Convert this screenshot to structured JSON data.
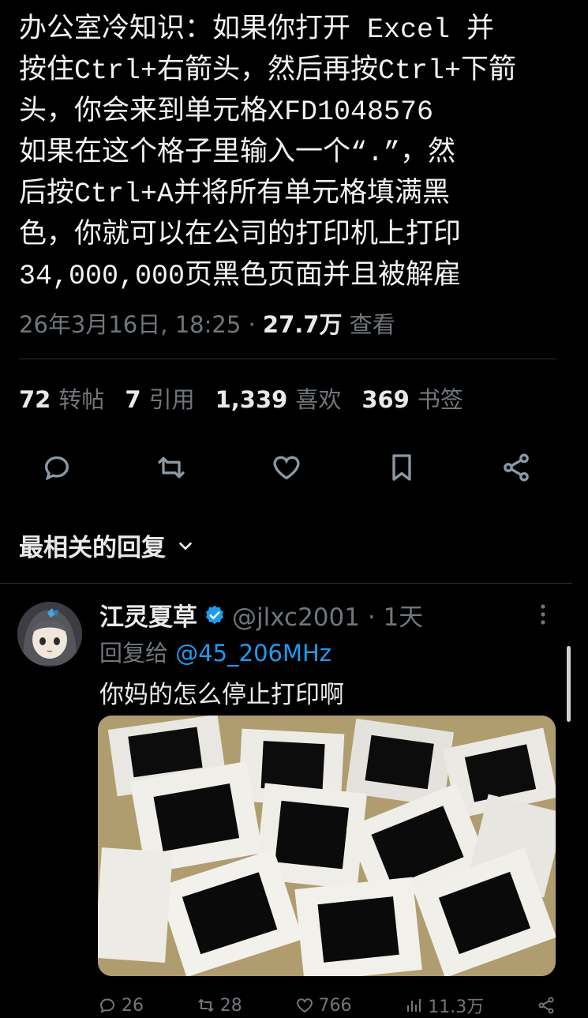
{
  "tweet": {
    "text": "办公室冷知识：如果你打开 Excel 并\n按住Ctrl+右箭头，然后再按Ctrl+下箭\n头，你会来到单元格XFD1048576\n如果在这个格子里输入一个“.”，然\n后按Ctrl+A并将所有单元格填满黑\n色，你就可以在公司的打印机上打印\n34,000,000页黑色页面并且被解雇",
    "timestamp": "26年3月16日, 18:25 · ",
    "views_count": "27.7万",
    "views_label": " 查看"
  },
  "stats": [
    {
      "count": "72",
      "label": "转帖"
    },
    {
      "count": "7",
      "label": "引用"
    },
    {
      "count": "1,339",
      "label": "喜欢"
    },
    {
      "count": "369",
      "label": "书签"
    }
  ],
  "sort_label": "最相关的回复",
  "reply": {
    "name": "江灵夏草",
    "handle": "@jlxc2001 · 1天",
    "reply_to_prefix": "回复给 ",
    "reply_to_mention": "@45_206MHz",
    "text": "你妈的怎么停止打印啊",
    "counts": {
      "replies": "26",
      "retweets": "28",
      "likes": "766",
      "views": "11.3万"
    }
  },
  "colors": {
    "accent": "#1d9bf0",
    "muted": "#71767b",
    "verified": "#1d9bf0"
  }
}
